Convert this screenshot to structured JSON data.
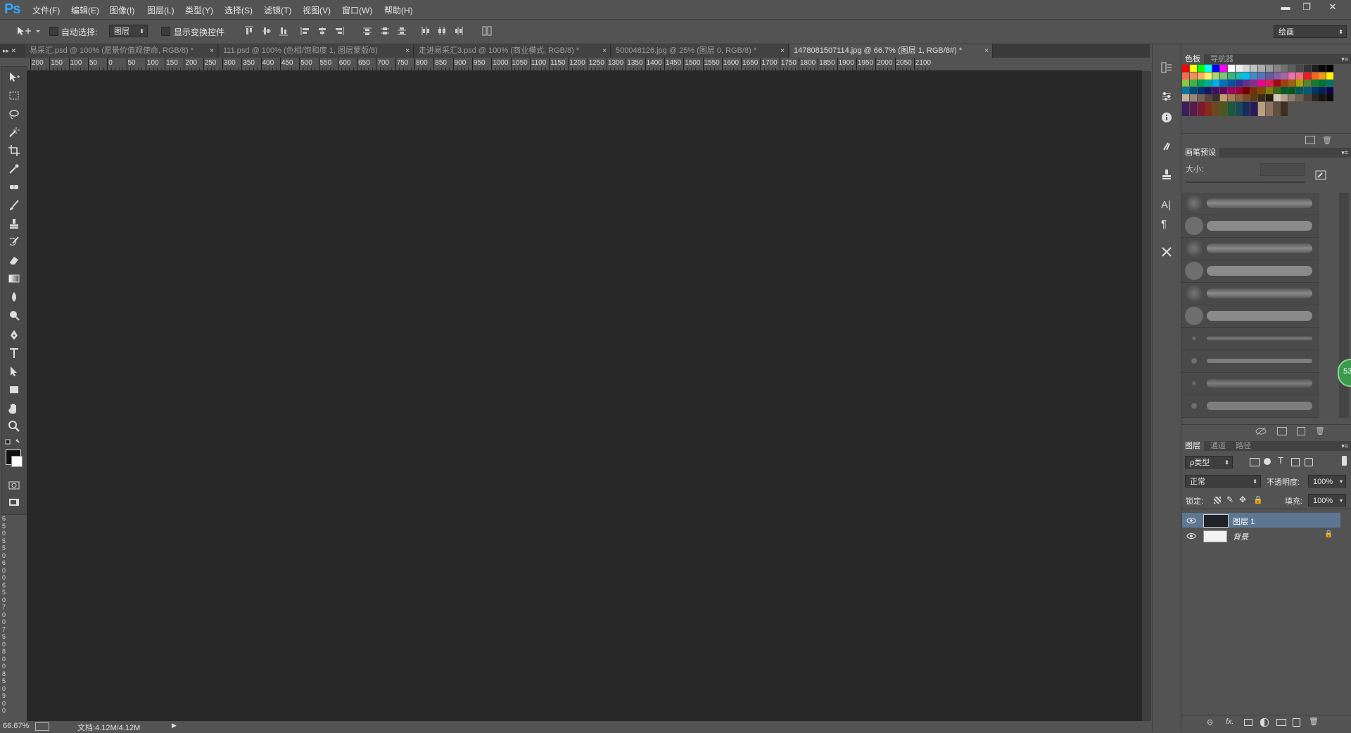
{
  "app": {
    "logo": "Ps",
    "menu": [
      "文件(F)",
      "编辑(E)",
      "图像(I)",
      "图层(L)",
      "类型(Y)",
      "选择(S)",
      "滤镜(T)",
      "视图(V)",
      "窗口(W)",
      "帮助(H)"
    ],
    "window_controls": {
      "minimize": "▬",
      "restore": "❐",
      "close": "✕"
    }
  },
  "options": {
    "auto_select_label": "自动选择:",
    "auto_select_value": "图层",
    "show_transform_label": "显示变换控件",
    "workspace_value": "绘画"
  },
  "tabs": [
    {
      "label": "易采汇.psd @ 100% (愿景价值观使命, RGB/8) *",
      "active": false
    },
    {
      "label": "111.psd @ 100% (色相/饱和度 1, 图层蒙版/8)",
      "active": false
    },
    {
      "label": "走进易采汇3.psd @ 100% (商业模式, RGB/8) *",
      "active": false
    },
    {
      "label": "500048126.jpg @ 25% (图层 0, RGB/8) *",
      "active": false
    },
    {
      "label": "1478081507114.jpg @ 66.7% (图层 1, RGB/8#) *",
      "active": true
    }
  ],
  "tab_close": "×",
  "ruler_top": [
    "200",
    "150",
    "100",
    "50",
    "0",
    "50",
    "100",
    "150",
    "200",
    "250",
    "300",
    "350",
    "400",
    "450",
    "500",
    "550",
    "600",
    "650",
    "700",
    "750",
    "800",
    "850",
    "900",
    "950",
    "1000",
    "1050",
    "1100",
    "1150",
    "1200",
    "1250",
    "1300",
    "1350",
    "1400",
    "1450",
    "1500",
    "1550",
    "1600",
    "1650",
    "1700",
    "1750",
    "1800",
    "1850",
    "1900",
    "1950",
    "2000",
    "2050",
    "2100"
  ],
  "ruler_left": [
    "6",
    "5",
    "0",
    "5",
    "5",
    "0",
    "6",
    "0",
    "0",
    "6",
    "5",
    "0",
    "7",
    "0",
    "0",
    "7",
    "5",
    "0",
    "8",
    "0",
    "0",
    "8",
    "5",
    "0",
    "9",
    "0",
    "0"
  ],
  "status": {
    "zoom": "66.67%",
    "doc": "文档:4.12M/4.12M",
    "arrow": "▶"
  },
  "panels": {
    "swatches": {
      "tabs": [
        "色板",
        "导航器"
      ]
    },
    "brush": {
      "title": "画笔预设",
      "size_label": "大小:"
    },
    "layers": {
      "tabs": [
        "图层",
        "通道",
        "路径"
      ],
      "filter_kind": "ρ类型",
      "blend_mode": "正常",
      "opacity_label": "不透明度:",
      "opacity_value": "100%",
      "lock_label": "锁定:",
      "fill_label": "填充:",
      "fill_value": "100%",
      "items": [
        {
          "name": "图层 1",
          "selected": true
        },
        {
          "name": "背景",
          "selected": false
        }
      ],
      "footer_icons": [
        "link-icon",
        "fx-icon",
        "mask-icon",
        "adjustment-icon",
        "folder-icon",
        "new-layer-icon",
        "trash-icon"
      ]
    }
  },
  "badge": "53",
  "colors": {
    "accent": "#31a8ff",
    "canvas": "#282828",
    "chrome": "#535353",
    "selected_layer": "#5d7694"
  }
}
